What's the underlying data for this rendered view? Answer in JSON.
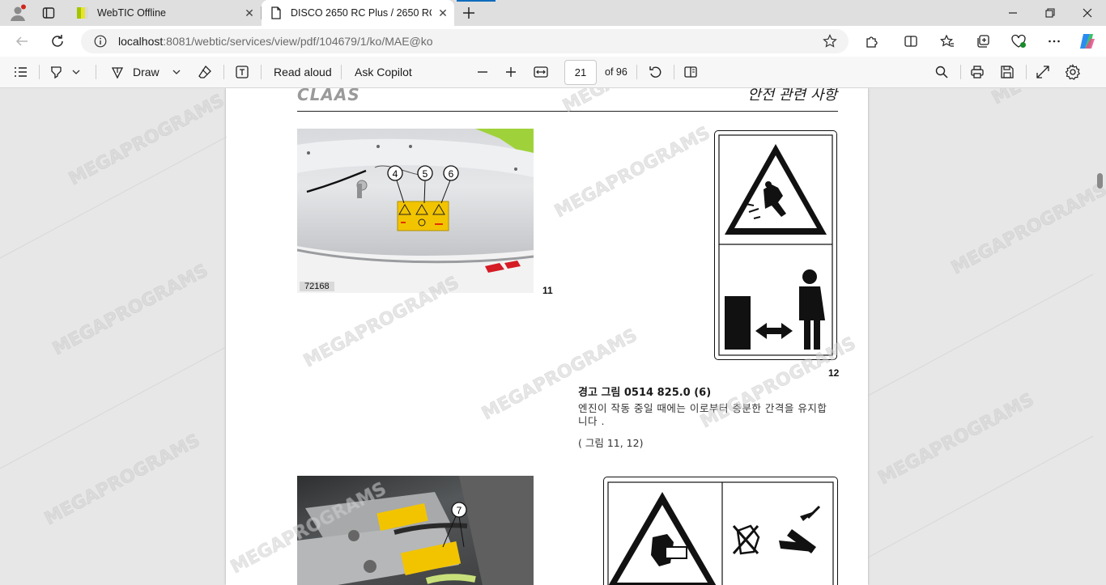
{
  "browser": {
    "tabs": [
      {
        "title": "WebTIC Offline",
        "active": false
      },
      {
        "title": "DISCO 2650 RC Plus / 2650 RC",
        "active": true
      }
    ],
    "url_host": "localhost",
    "url_rest": ":8081/webtic/services/view/pdf/104679/1/ko/MAE@ko"
  },
  "pdf_toolbar": {
    "draw_label": "Draw",
    "read_aloud_label": "Read aloud",
    "ask_copilot_label": "Ask Copilot",
    "current_page": "21",
    "total_pages": "of 96"
  },
  "document": {
    "header_title": "안전 관련 사항",
    "logo_text": "CLAAS",
    "photo1_label": "72168",
    "photo1_callouts": [
      "4",
      "5",
      "6"
    ],
    "photo2_callouts": [
      "7"
    ],
    "fig11_number": "11",
    "fig12_number": "12",
    "warning_heading": "경고 그림 0514 825.0 (6)",
    "warning_body": "엔진이 작동 중일 때에는 이로부터 충분한 간격을 유지합니다 .",
    "warning_ref": "( 그림 11, 12)",
    "watermark": "MEGAPROGRAMS"
  },
  "colors": {
    "decal_yellow": "#f2c400",
    "browser_accent": "#0f6cbd"
  }
}
